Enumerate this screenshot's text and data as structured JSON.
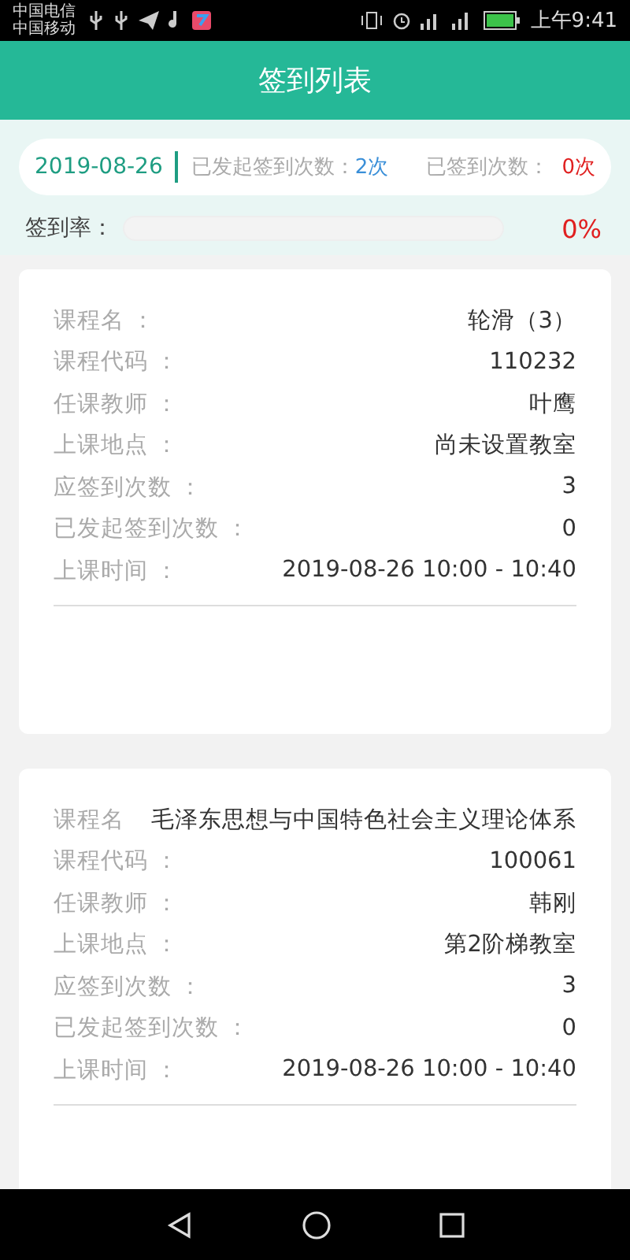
{
  "status_bar": {
    "carriers": [
      "中国电信",
      "中国移动"
    ],
    "time": "上午9:41"
  },
  "header": {
    "title": "签到列表"
  },
  "summary": {
    "date": "2019-08-26",
    "started_label": "已发起签到次数：",
    "started_value": "2次",
    "signed_label": "已签到次数：",
    "signed_value": "0次"
  },
  "rate": {
    "label": "签到率：",
    "level": 0,
    "value": "0%"
  },
  "courses": [
    {
      "rows": [
        {
          "label": "课程名 ：",
          "value": "轮滑（3）"
        },
        {
          "label": "课程代码 ：",
          "value": "110232"
        },
        {
          "label": "任课教师 ：",
          "value": "叶鹰"
        },
        {
          "label": "上课地点 ：",
          "value": "尚未设置教室"
        },
        {
          "label": "应签到次数 ：",
          "value": "3"
        },
        {
          "label": "已发起签到次数 ：",
          "value": "0"
        },
        {
          "label": "上课时间 ：",
          "value": "2019-08-26 10:00 - 10:40"
        }
      ]
    },
    {
      "rows": [
        {
          "label": "课程名",
          "value": "毛泽东思想与中国特色社会主义理论体系"
        },
        {
          "label": "课程代码 ：",
          "value": "100061"
        },
        {
          "label": "任课教师 ：",
          "value": "韩刚"
        },
        {
          "label": "上课地点 ：",
          "value": "第2阶梯教室"
        },
        {
          "label": "应签到次数 ：",
          "value": "3"
        },
        {
          "label": "已发起签到次数 ：",
          "value": "0"
        },
        {
          "label": "上课时间 ：",
          "value": "2019-08-26 10:00 - 10:40"
        }
      ]
    }
  ]
}
